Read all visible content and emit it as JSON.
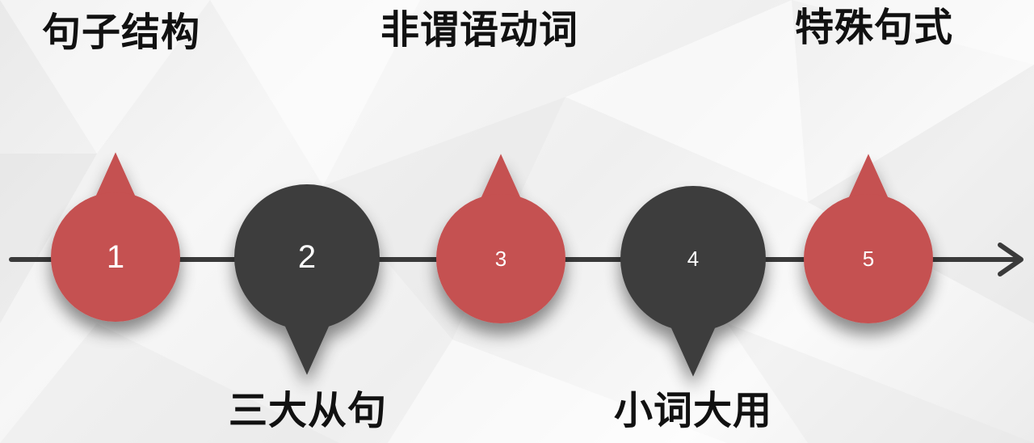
{
  "steps": [
    {
      "number": "1",
      "label": "句子结构",
      "color": "#c55151",
      "pointer": "up"
    },
    {
      "number": "2",
      "label": "三大从句",
      "color": "#3d3d3d",
      "pointer": "down"
    },
    {
      "number": "3",
      "label": "非谓语动词",
      "color": "#c55151",
      "pointer": "up"
    },
    {
      "number": "4",
      "label": "小词大用",
      "color": "#3d3d3d",
      "pointer": "down"
    },
    {
      "number": "5",
      "label": "特殊句式",
      "color": "#c55151",
      "pointer": "up"
    }
  ],
  "colors": {
    "line": "#3a3a3a",
    "red": "#c55151",
    "dark": "#3d3d3d",
    "text": "#111111"
  }
}
